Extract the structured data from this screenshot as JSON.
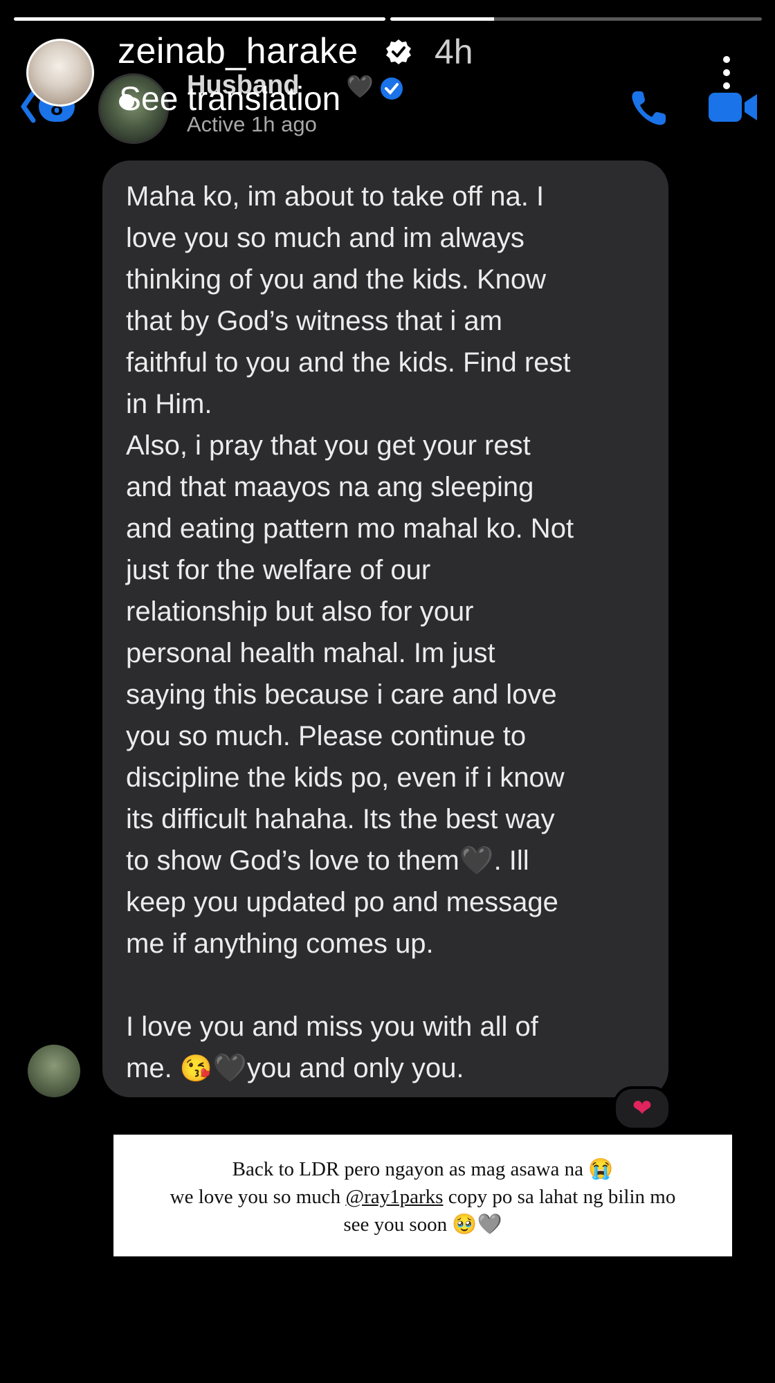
{
  "story": {
    "username": "zeinab_harake",
    "time": "4h",
    "translation": "See translation",
    "progress": [
      1.0,
      0.28
    ]
  },
  "chat_header": {
    "back_count": "8",
    "contact_name": "Husband",
    "contact_heart": "🖤",
    "status": "Active 1h ago"
  },
  "message": {
    "lines": [
      "Maha ko, im about to take off na. I",
      "love you so much and im always",
      "thinking of you and the kids. Know",
      "that by God’s witness that i am",
      "faithful to you and the kids. Find rest",
      "in Him.",
      "Also, i pray that you get your rest",
      "and that maayos na ang sleeping",
      "and eating pattern mo mahal ko. Not",
      "just for the welfare of our",
      "relationship but also for your",
      "personal health mahal. Im just",
      "saying this because i care and love",
      "you so much. Please continue to",
      "discipline the kids po, even if i know",
      "its difficult hahaha. Its the best way"
    ],
    "line17_text": "to show God’s love to them",
    "line17_heart": "🖤",
    "line17_after": ". Ill",
    "line18": "keep you updated po and message",
    "line19": "me if anything comes up.",
    "line21": "I love you and miss you with all of",
    "line22_start": "me. ",
    "line22_kiss": "😘",
    "line22_heart": "🖤",
    "line22_end": "you and only you.",
    "reaction": "❤"
  },
  "caption": {
    "line1": "Back to LDR pero ngayon as mag asawa na 😭",
    "line2_start": "we love you so much ",
    "line2_mention": "@ray1parks",
    "line2_end": " copy po sa lahat ng bilin mo",
    "line3": "see you soon 🥹🩶"
  },
  "colors": {
    "background": "#000000",
    "bubble": "#2c2c2e",
    "accent_blue": "#1a73e8",
    "reaction_heart": "#e0245e"
  },
  "icons": [
    "back-icon",
    "verified-icon",
    "phone-icon",
    "video-icon",
    "more-icon",
    "heart-icon"
  ]
}
